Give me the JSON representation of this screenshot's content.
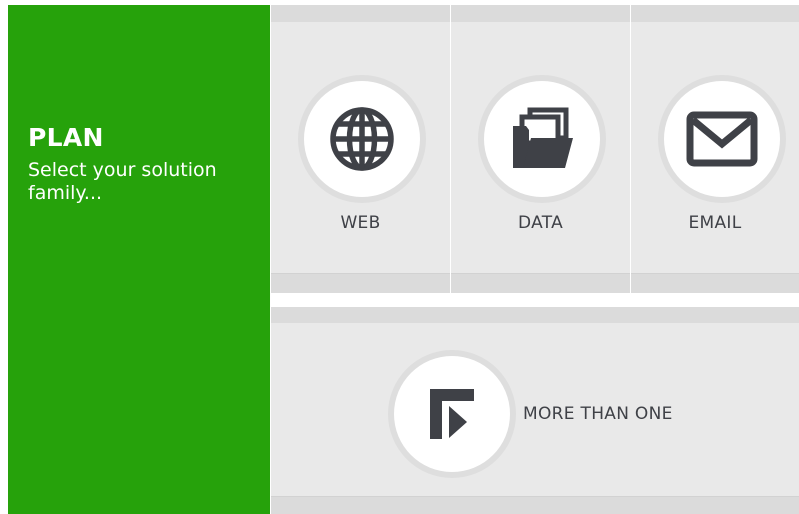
{
  "plan": {
    "title": "PLAN",
    "subtitle": "Select your solution family..."
  },
  "options": [
    {
      "label": "WEB",
      "icon": "globe-icon"
    },
    {
      "label": "DATA",
      "icon": "folder-icon"
    },
    {
      "label": "EMAIL",
      "icon": "envelope-icon"
    }
  ],
  "more": {
    "label": "MORE THAN ONE",
    "icon": "corner-arrow-icon"
  },
  "colors": {
    "accent_green": "#26a20b",
    "panel_gray": "#e9e9e9",
    "icon_dark": "#3f4147"
  }
}
